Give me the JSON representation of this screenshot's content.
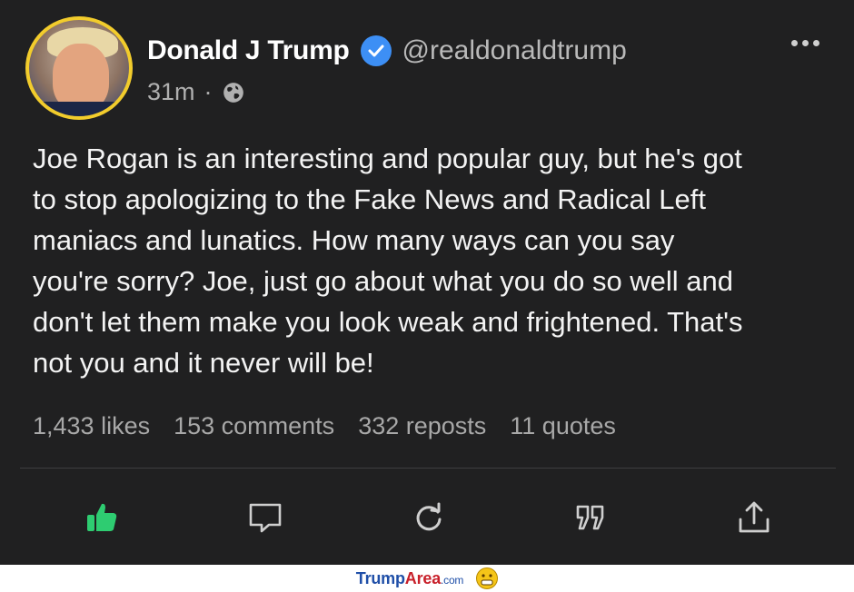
{
  "author": {
    "display_name": "Donald J Trump",
    "handle": "@realdonaldtrump",
    "verified_icon": "verified-check-icon"
  },
  "meta": {
    "time": "31m",
    "separator": "·",
    "visibility_icon": "globe-icon"
  },
  "post": {
    "text": "Joe Rogan is an interesting and popular guy, but he's got\nto stop apologizing to the Fake News and Radical Left\nmaniacs and lunatics. How many ways can you say\nyou're sorry? Joe, just go about what you do so well and\ndon't let them make you look weak and frightened. That's\nnot you and it never will be!"
  },
  "stats": {
    "likes": "1,433 likes",
    "comments": "153 comments",
    "reposts": "332 reposts",
    "quotes": "11 quotes"
  },
  "actions": [
    {
      "name": "like",
      "icon": "thumbs-up-icon",
      "active": true
    },
    {
      "name": "comment",
      "icon": "comment-bubble-icon"
    },
    {
      "name": "repost",
      "icon": "repost-icon"
    },
    {
      "name": "quote",
      "icon": "quote-icon"
    },
    {
      "name": "share",
      "icon": "share-icon"
    }
  ],
  "footer": {
    "brand_part1": "Trump",
    "brand_part2": "Area",
    "brand_part3": ".com",
    "icon": "emoji-face-icon"
  },
  "colors": {
    "background": "#202021",
    "avatar_ring": "#f2cc2c",
    "verified": "#3d8ff5",
    "like_active": "#2ecc71",
    "muted_text": "#a8a8a8"
  }
}
